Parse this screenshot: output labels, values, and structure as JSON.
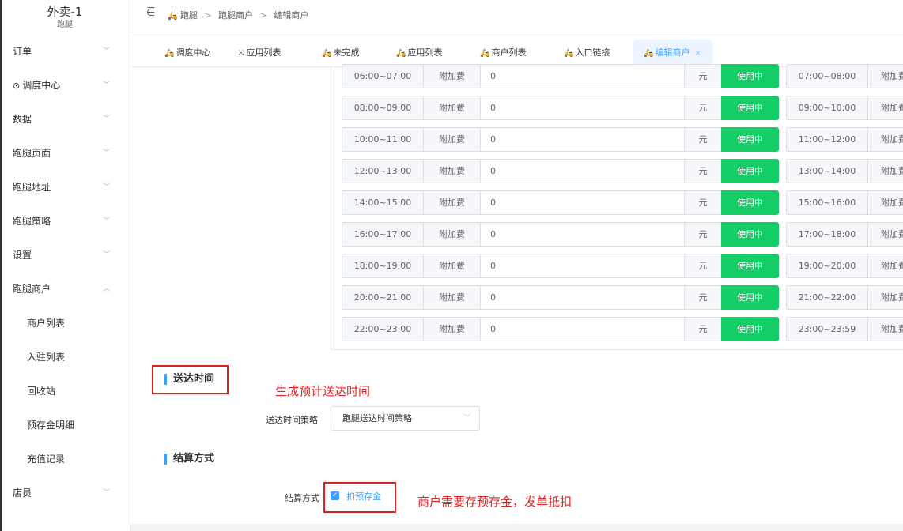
{
  "sidebar": {
    "title": "外卖-1",
    "subtitle": "跑腿",
    "items": [
      {
        "label": "订单",
        "arrow": "﹀"
      },
      {
        "label": "调度中心",
        "icon": "target-icon",
        "arrow": "﹀"
      },
      {
        "label": "数据",
        "arrow": "﹀"
      },
      {
        "label": "跑腿页面",
        "arrow": "﹀"
      },
      {
        "label": "跑腿地址",
        "arrow": "﹀"
      },
      {
        "label": "跑腿策略",
        "arrow": "﹀"
      },
      {
        "label": "设置",
        "arrow": "﹀"
      },
      {
        "label": "跑腿商户",
        "arrow": "︿"
      }
    ],
    "sub_items": [
      "商户列表",
      "入驻列表",
      "回收站",
      "预存金明细",
      "充值记录"
    ],
    "last_item": {
      "label": "店员",
      "arrow": "﹀"
    }
  },
  "topbar": {
    "fold_icon": "⋶",
    "breadcrumb": [
      "跑腿",
      "跑腿商户",
      "编辑商户"
    ],
    "separator": ">"
  },
  "tabs": [
    {
      "label": "调度中心",
      "icon": "bike-icon"
    },
    {
      "label": "应用列表",
      "icon": "grid-icon"
    },
    {
      "label": "未完成",
      "icon": "bike-icon"
    },
    {
      "label": "应用列表",
      "icon": "bike-icon"
    },
    {
      "label": "商户列表",
      "icon": "bike-icon"
    },
    {
      "label": "入口链接",
      "icon": "bike-icon"
    },
    {
      "label": "编辑商户",
      "icon": "bike-icon",
      "active": true,
      "close": "×"
    }
  ],
  "time_slots": [
    {
      "time": "06:00~07:00",
      "fee_label": "附加费",
      "value": "0",
      "unit": "元",
      "status": "使用中",
      "next_time": "07:00~08:00",
      "next_fee_label": "附加费"
    },
    {
      "time": "08:00~09:00",
      "fee_label": "附加费",
      "value": "0",
      "unit": "元",
      "status": "使用中",
      "next_time": "09:00~10:00",
      "next_fee_label": "附加费"
    },
    {
      "time": "10:00~11:00",
      "fee_label": "附加费",
      "value": "0",
      "unit": "元",
      "status": "使用中",
      "next_time": "11:00~12:00",
      "next_fee_label": "附加费"
    },
    {
      "time": "12:00~13:00",
      "fee_label": "附加费",
      "value": "0",
      "unit": "元",
      "status": "使用中",
      "next_time": "13:00~14:00",
      "next_fee_label": "附加费"
    },
    {
      "time": "14:00~15:00",
      "fee_label": "附加费",
      "value": "0",
      "unit": "元",
      "status": "使用中",
      "next_time": "15:00~16:00",
      "next_fee_label": "附加费"
    },
    {
      "time": "16:00~17:00",
      "fee_label": "附加费",
      "value": "0",
      "unit": "元",
      "status": "使用中",
      "next_time": "17:00~18:00",
      "next_fee_label": "附加费"
    },
    {
      "time": "18:00~19:00",
      "fee_label": "附加费",
      "value": "0",
      "unit": "元",
      "status": "使用中",
      "next_time": "19:00~20:00",
      "next_fee_label": "附加费"
    },
    {
      "time": "20:00~21:00",
      "fee_label": "附加费",
      "value": "0",
      "unit": "元",
      "status": "使用中",
      "next_time": "21:00~22:00",
      "next_fee_label": "附加费"
    },
    {
      "time": "22:00~23:00",
      "fee_label": "附加费",
      "value": "0",
      "unit": "元",
      "status": "使用中",
      "next_time": "23:00~23:59",
      "next_fee_label": "附加费"
    }
  ],
  "delivery": {
    "section_title": "送达时间",
    "annotation": "生成预计送达时间",
    "strategy_label": "送达时间策略",
    "strategy_value": "跑腿送达时间策略"
  },
  "settlement": {
    "section_title": "结算方式",
    "method_label": "结算方式",
    "option_label": "扣预存金",
    "checked": true,
    "annotation": "商户需要存预存金，发单抵扣"
  },
  "colors": {
    "accent": "#409eff",
    "status_green": "#13ce66",
    "annotation_red": "#e02020"
  }
}
